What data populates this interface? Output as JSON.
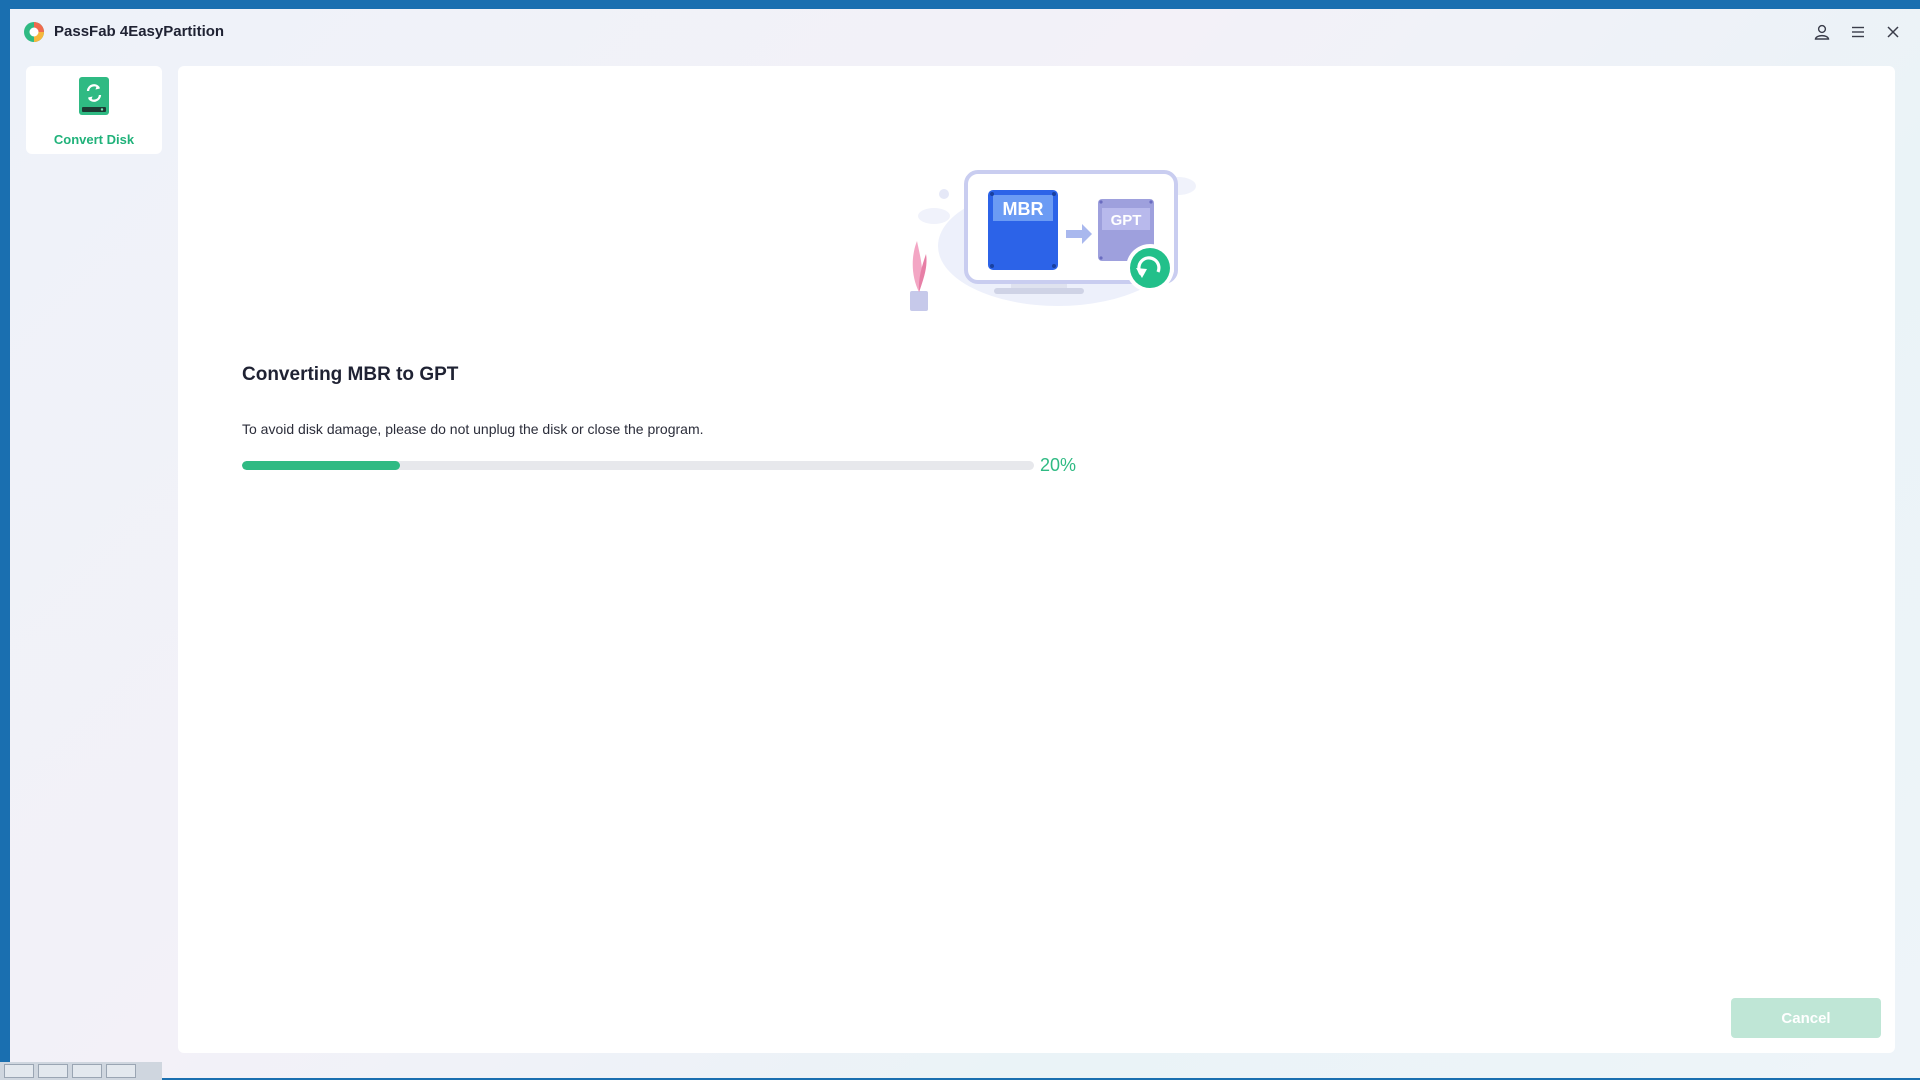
{
  "window": {
    "title": "PassFab 4EasyPartition"
  },
  "titlebar_icons": [
    "user-icon",
    "menu-icon",
    "close-icon"
  ],
  "sidebar": {
    "items": [
      {
        "label": "Convert Disk",
        "icon": "convert-disk-icon",
        "active": true
      }
    ]
  },
  "illustration": {
    "source_label": "MBR",
    "target_label": "GPT"
  },
  "main": {
    "heading": "Converting MBR to GPT",
    "note": "To avoid disk damage, please do not unplug the disk or close the program.",
    "progress": {
      "percent": 20,
      "label": "20%"
    },
    "cancel_label": "Cancel"
  },
  "colors": {
    "accent": "#2fba83",
    "desktop": "#1a6fb0",
    "cancel_disabled": "#bfe6d6"
  }
}
